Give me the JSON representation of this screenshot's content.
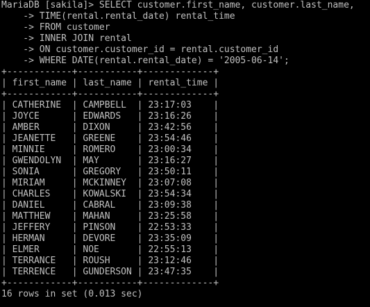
{
  "terminal": {
    "text_color": "#c0c0c0",
    "background": "#000000"
  },
  "query": {
    "lines": [
      "MariaDB [sakila]> SELECT customer.first_name, customer.last_name,",
      "    -> TIME(rental.rental_date) rental_time",
      "    -> FROM customer",
      "    -> INNER JOIN rental",
      "    -> ON customer.customer_id = rental.customer_id",
      "    -> WHERE DATE(rental.rental_date) = '2005-06-14';"
    ]
  },
  "result": {
    "border": "+------------+-----------+-------------+",
    "header": "| first_name | last_name | rental_time |",
    "rows": [
      "| CATHERINE  | CAMPBELL  | 23:17:03    |",
      "| JOYCE      | EDWARDS   | 23:16:26    |",
      "| AMBER      | DIXON     | 23:42:56    |",
      "| JEANETTE   | GREENE    | 23:54:46    |",
      "| MINNIE     | ROMERO    | 23:00:34    |",
      "| GWENDOLYN  | MAY       | 23:16:27    |",
      "| SONIA      | GREGORY   | 23:50:11    |",
      "| MIRIAM     | MCKINNEY  | 23:07:08    |",
      "| CHARLES    | KOWALSKI  | 23:54:34    |",
      "| DANIEL     | CABRAL    | 23:09:38    |",
      "| MATTHEW    | MAHAN     | 23:25:58    |",
      "| JEFFERY    | PINSON    | 22:53:33    |",
      "| HERMAN     | DEVORE    | 23:35:09    |",
      "| ELMER      | NOE       | 22:55:13    |",
      "| TERRANCE   | ROUSH     | 23:12:46    |",
      "| TERRENCE   | GUNDERSON | 23:47:35    |"
    ],
    "summary": "16 rows in set (0.013 sec)"
  }
}
